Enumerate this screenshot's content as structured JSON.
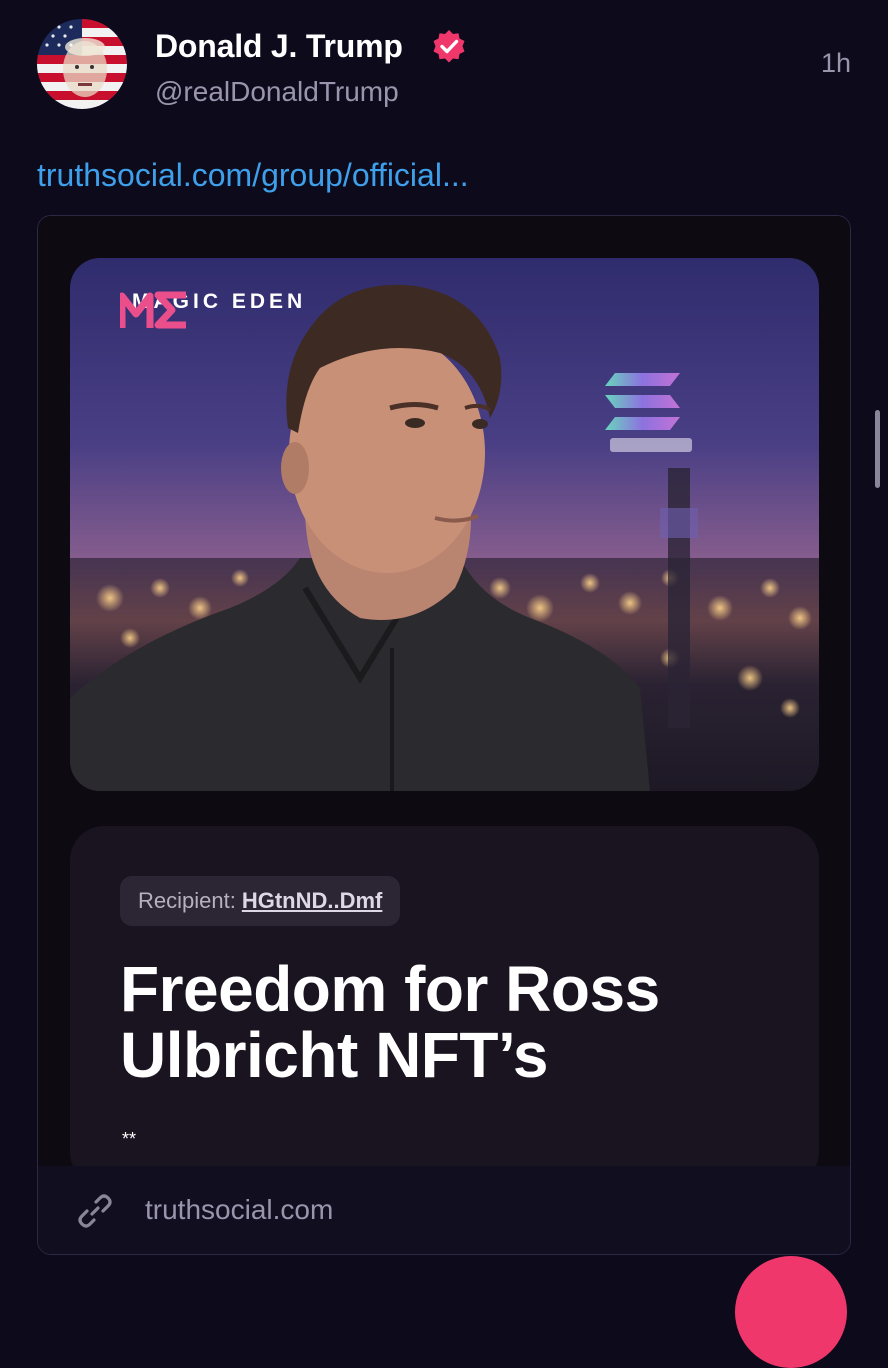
{
  "post": {
    "author": {
      "name": "Donald J. Trump",
      "handle": "@realDonaldTrump",
      "avatar_icon": "flag-portrait-avatar",
      "verified_icon": "verified-badge-icon"
    },
    "time": "1h",
    "link_text": "truthsocial.com/group/official..."
  },
  "card": {
    "brand": "MAGIC EDEN",
    "recipient_label": "Recipient:",
    "recipient_address": "HGtnND..Dmf",
    "headline": "Freedom for Ross Ulbricht NFT’s",
    "stars": "**",
    "footer_domain": "truthsocial.com",
    "footer_icon": "link-icon"
  },
  "colors": {
    "background": "#0d0a1c",
    "link": "#3ea0ea",
    "accent": "#f0376c",
    "muted": "#9a95ad"
  }
}
